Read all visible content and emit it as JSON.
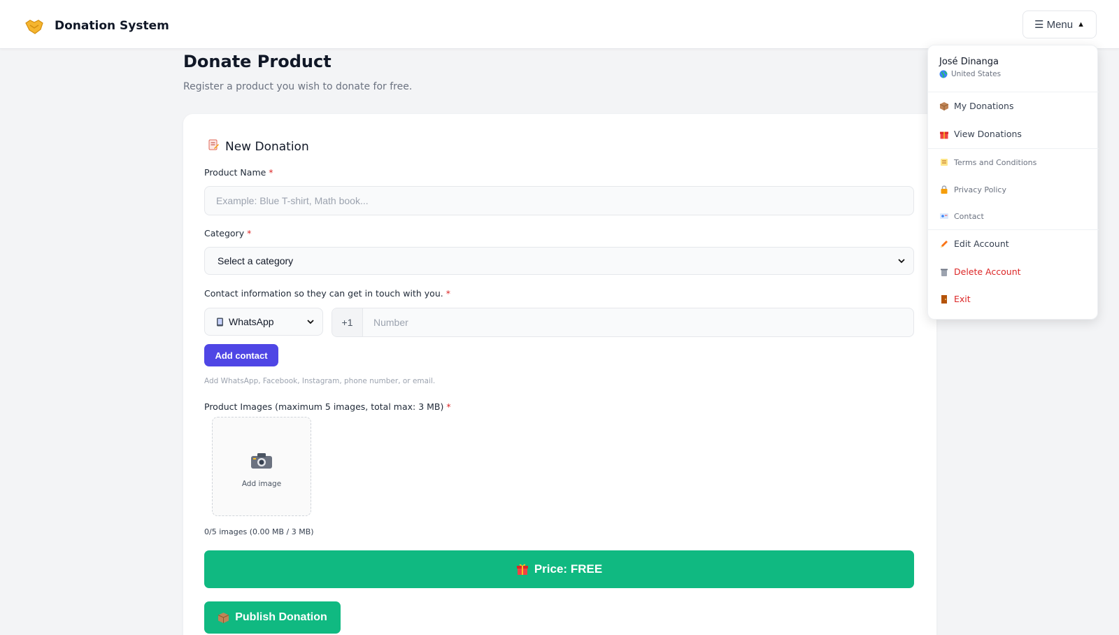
{
  "header": {
    "brand_icon": "handshake-icon",
    "title": "Donation System",
    "menu_label": "☰ Menu",
    "menu_caret": "▲"
  },
  "page": {
    "title": "Donate Product",
    "subtitle": "Register a product you wish to donate for free."
  },
  "form": {
    "card_title": "New Donation",
    "product_name": {
      "label": "Product Name",
      "required_mark": "*",
      "placeholder": "Example: Blue T-shirt, Math book..."
    },
    "category": {
      "label": "Category",
      "required_mark": "*",
      "selected": "Select a category"
    },
    "contact": {
      "label": "Contact information so they can get in touch with you.",
      "required_mark": "*",
      "type_selected": "WhatsApp",
      "prefix": "+1",
      "number_placeholder": "Number",
      "add_button": "Add contact",
      "hint": "Add WhatsApp, Facebook, Instagram, phone number, or email."
    },
    "images": {
      "label": "Product Images (maximum 5 images, total max: 3 MB)",
      "required_mark": "*",
      "add_label": "Add image",
      "count_text": "0/5 images (0.00 MB / 3 MB)"
    },
    "price_label": "Price: FREE",
    "publish_label": "Publish Donation"
  },
  "menu": {
    "user_name": "José Dinanga",
    "user_country": "United States",
    "items": [
      {
        "label": "My Donations",
        "icon": "box-icon"
      },
      {
        "label": "View Donations",
        "icon": "gift-icon"
      },
      {
        "label": "Terms and Conditions",
        "icon": "scroll-icon"
      },
      {
        "label": "Privacy Policy",
        "icon": "lock-icon"
      },
      {
        "label": "Contact",
        "icon": "id-card-icon"
      },
      {
        "label": "Edit Account",
        "icon": "pencil-icon"
      },
      {
        "label": "Delete Account",
        "icon": "trash-icon"
      },
      {
        "label": "Exit",
        "icon": "door-icon"
      }
    ]
  },
  "colors": {
    "primary": "#4f46e5",
    "success": "#10b981",
    "danger": "#dc2626",
    "background": "#f3f4f6"
  }
}
